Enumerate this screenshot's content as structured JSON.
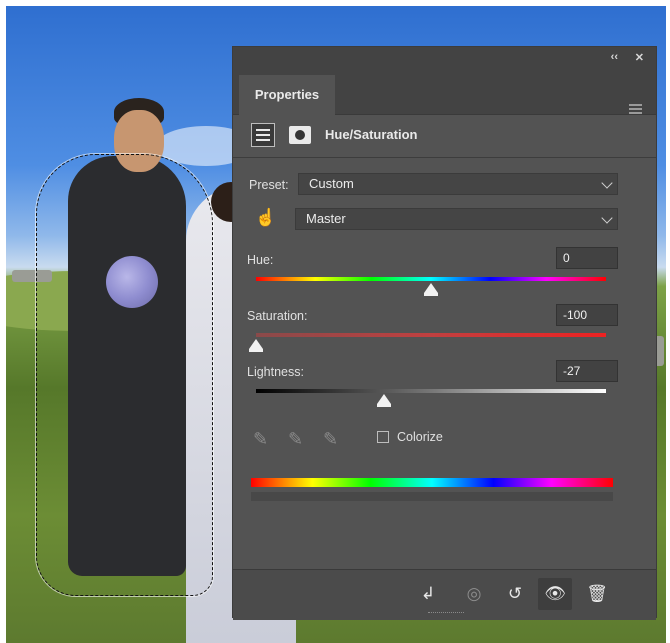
{
  "panel": {
    "tab_label": "Properties",
    "collapse_icon": "double-chevron-left",
    "close_icon": "close",
    "collapse_text": "‹‹",
    "close_text": "✕",
    "adjustment_title": "Hue/Saturation",
    "preset": {
      "label": "Preset:",
      "value": "Custom"
    },
    "channel": {
      "value": "Master"
    },
    "hue": {
      "label": "Hue:",
      "value": "0",
      "slider_fraction": 0.5
    },
    "saturation": {
      "label": "Saturation:",
      "value": "-100",
      "slider_fraction": 0.0
    },
    "lightness": {
      "label": "Lightness:",
      "value": "-27",
      "slider_fraction": 0.365
    },
    "colorize": {
      "label": "Colorize",
      "checked": false
    },
    "bottom_buttons": [
      {
        "name": "clip-to-layer",
        "glyph": "↲"
      },
      {
        "name": "view-previous-state",
        "glyph": "◎"
      },
      {
        "name": "reset",
        "glyph": "↺"
      },
      {
        "name": "toggle-visibility",
        "glyph": "👁"
      },
      {
        "name": "delete",
        "glyph": "🗑"
      }
    ]
  }
}
